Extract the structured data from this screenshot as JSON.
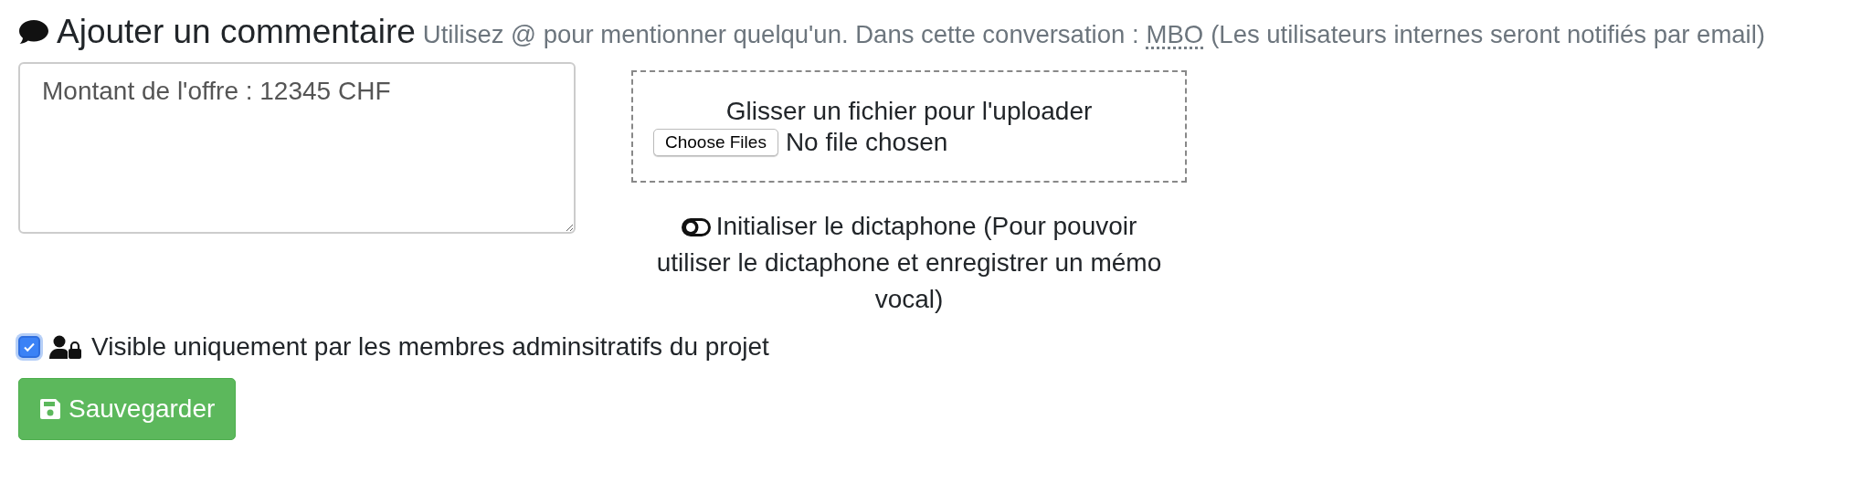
{
  "heading": {
    "title": "Ajouter un commentaire",
    "hint_before": "Utilisez @ pour mentionner quelqu'un. Dans cette conversation :",
    "mentions": [
      "MBO"
    ],
    "hint_after": "(Les utilisateurs internes seront notifiés par email)"
  },
  "comment": {
    "value": "Montant de l'offre : 12345 CHF"
  },
  "upload": {
    "label": "Glisser un fichier pour l'uploader",
    "button": "Choose Files",
    "status": "No file chosen"
  },
  "dictaphone": {
    "label": "Initialiser le dictaphone (Pour pouvoir utiliser le dictaphone et enregistrer un mémo vocal)"
  },
  "visibility": {
    "label": "Visible uniquement par les membres adminsitratifs du projet",
    "checked": true
  },
  "save_button": {
    "label": "Sauvegarder"
  }
}
